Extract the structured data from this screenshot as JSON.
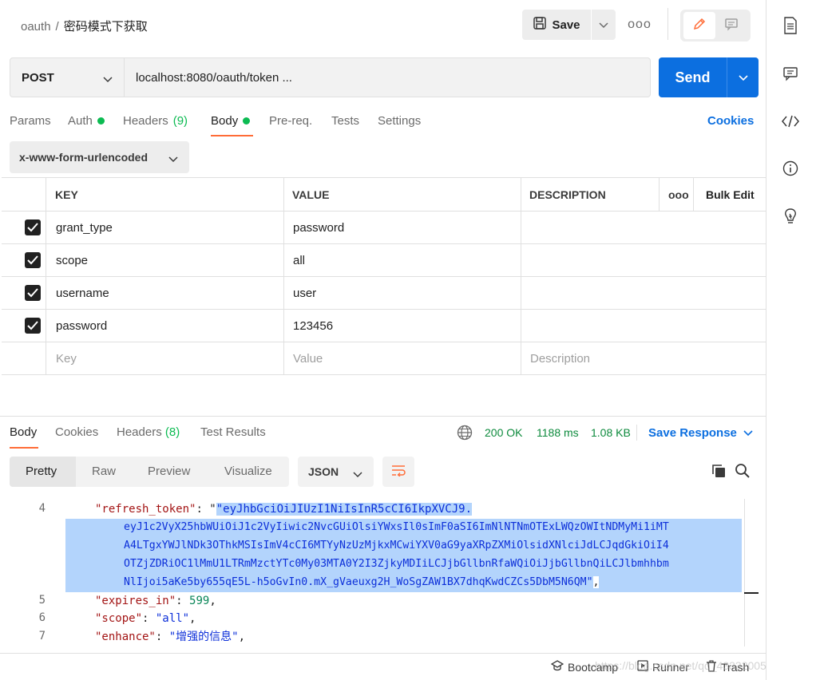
{
  "header": {
    "breadcrumb_collection": "oauth",
    "breadcrumb_sep": "/",
    "request_name": "密码模式下获取",
    "save_label": "Save",
    "more_label": "ooo"
  },
  "request": {
    "method": "POST",
    "url": "localhost:8080/oauth/token ...",
    "send_label": "Send",
    "tabs": [
      {
        "label": "Params",
        "count": "",
        "dot": false
      },
      {
        "label": "Auth",
        "count": "",
        "dot": true
      },
      {
        "label": "Headers",
        "count": "(9)",
        "dot": false
      },
      {
        "label": "Body",
        "count": "",
        "dot": true
      },
      {
        "label": "Pre-req.",
        "count": "",
        "dot": false
      },
      {
        "label": "Tests",
        "count": "",
        "dot": false
      },
      {
        "label": "Settings",
        "count": "",
        "dot": false
      }
    ],
    "active_tab": "Body",
    "cookies_label": "Cookies",
    "body_type": "x-www-form-urlencoded"
  },
  "table": {
    "headers": {
      "key": "KEY",
      "value": "VALUE",
      "description": "DESCRIPTION",
      "more": "ooo",
      "bulk_edit": "Bulk Edit"
    },
    "rows": [
      {
        "key": "grant_type",
        "value": "password",
        "checked": true
      },
      {
        "key": "scope",
        "value": "all",
        "checked": true
      },
      {
        "key": "username",
        "value": "user",
        "checked": true
      },
      {
        "key": "password",
        "value": "123456",
        "checked": true
      }
    ],
    "placeholders": {
      "key": "Key",
      "value": "Value",
      "description": "Description"
    }
  },
  "response": {
    "tabs": {
      "body": "Body",
      "cookies": "Cookies",
      "headers": "Headers",
      "headers_count": "(8)",
      "test_results": "Test Results"
    },
    "status": "200 OK",
    "time": "1188 ms",
    "size": "1.08 KB",
    "save_response": "Save Response",
    "views": [
      "Pretty",
      "Raw",
      "Preview",
      "Visualize"
    ],
    "active_view": "Pretty",
    "format": "JSON",
    "lines": [
      {
        "num": "4",
        "key": "\"refresh_token\"",
        "value_lines": [
          "\"eyJhbGciOiJIUzI1NiIsInR5cCI6IkpXVCJ9.",
          "eyJ1c2VyX25hbWUiOiJ1c2VyIiwic2NvcGUiOlsiYWxsIl0sImF0aSI6ImNlNTNmOTExLWQzOWItNDMyMi1iMT",
          "A4LTgxYWJlNDk3OThkMSIsImV4cCI6MTYyNzUzMjkxMCwiYXV0aG9yaXRpZXMiOlsidXNlciJdLCJqdGkiOiI4",
          "OTZjZDRiOC1lMmU1LTRmMzctYTc0My03MTA0Y2I3ZjkyMDIiLCJjbGllbnRfaWQiOiJjbGllbnQiLCJlbmhhbm",
          "NlIjoi5aKe5by655qE5L-h5oGvIn0.mX_gVaeuxg2H_WoSgZAW1BX7dhqKwdCZCs5DbM5N6QM\""
        ]
      },
      {
        "num": "5",
        "key": "\"expires_in\"",
        "value": "599"
      },
      {
        "num": "6",
        "key": "\"scope\"",
        "value": "\"all\""
      },
      {
        "num": "7",
        "key": "\"enhance\"",
        "value": "\"增强的信息\""
      }
    ]
  },
  "footer": {
    "bootcamp": "Bootcamp",
    "runner": "Runner",
    "trash": "Trash"
  },
  "watermark": "https://blog.csdn.net/qq_43332005"
}
